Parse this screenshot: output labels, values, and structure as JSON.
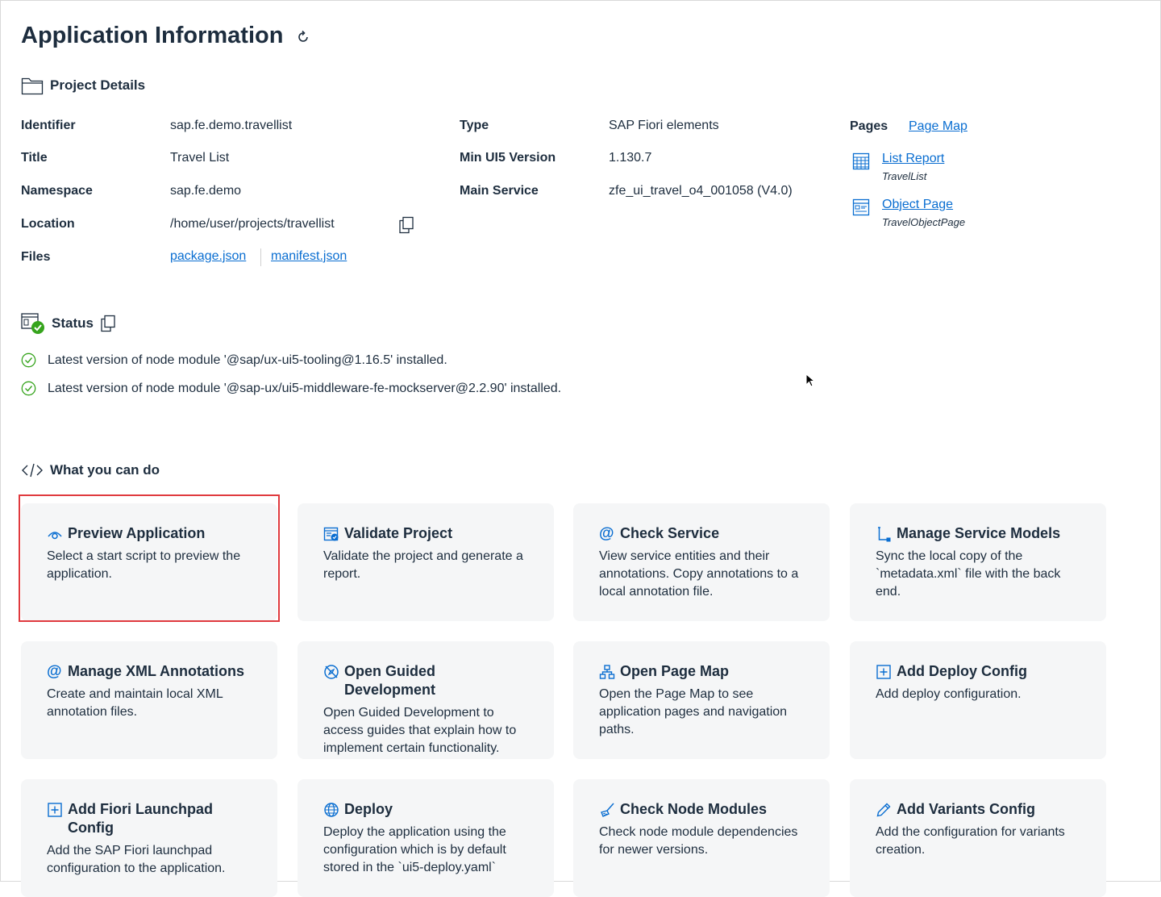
{
  "page": {
    "title": "Application Information"
  },
  "project_details": {
    "heading": "Project Details",
    "identifier_label": "Identifier",
    "identifier_value": "sap.fe.demo.travellist",
    "title_label": "Title",
    "title_value": "Travel List",
    "namespace_label": "Namespace",
    "namespace_value": "sap.fe.demo",
    "location_label": "Location",
    "location_value": "/home/user/projects/travellist",
    "files_label": "Files",
    "files": [
      "package.json",
      "manifest.json"
    ],
    "type_label": "Type",
    "type_value": "SAP Fiori elements",
    "min_ui5_label": "Min UI5 Version",
    "min_ui5_value": "1.130.7",
    "main_service_label": "Main Service",
    "main_service_value": "zfe_ui_travel_o4_001058 (V4.0)",
    "pages_label": "Pages",
    "page_map_link": "Page Map",
    "pages": [
      {
        "name": "List Report",
        "entity": "TravelList",
        "icon": "table-icon"
      },
      {
        "name": "Object Page",
        "entity": "TravelObjectPage",
        "icon": "form-icon"
      }
    ]
  },
  "status": {
    "heading": "Status",
    "items": [
      "Latest version of node module '@sap/ux-ui5-tooling@1.16.5' installed.",
      "Latest version of node module '@sap-ux/ui5-middleware-fe-mockserver@2.2.90' installed."
    ]
  },
  "actions": {
    "heading": "What you can do",
    "cards": [
      {
        "title": "Preview Application",
        "desc": "Select a start script to preview the application.",
        "icon": "eye-icon"
      },
      {
        "title": "Validate Project",
        "desc": "Validate the project and generate a report.",
        "icon": "validate-icon"
      },
      {
        "title": "Check Service",
        "desc": "View service entities and their annotations. Copy annotations to a local annotation file.",
        "icon": "at-icon"
      },
      {
        "title": "Manage Service Models",
        "desc": "Sync the local copy of the `metadata.xml` file with the back end.",
        "icon": "model-icon"
      },
      {
        "title": "Manage XML Annotations",
        "desc": "Create and maintain local XML annotation files.",
        "icon": "at-icon"
      },
      {
        "title": "Open Guided Development",
        "desc": "Open Guided Development to access guides that explain how to implement certain functionality.",
        "icon": "guide-icon"
      },
      {
        "title": "Open Page Map",
        "desc": "Open the Page Map to see application pages and navigation paths.",
        "icon": "hierarchy-icon"
      },
      {
        "title": "Add Deploy Config",
        "desc": "Add deploy configuration.",
        "icon": "add-icon"
      },
      {
        "title": "Add Fiori Launchpad Config",
        "desc": "Add the SAP Fiori launchpad configuration to the application.",
        "icon": "add-icon"
      },
      {
        "title": "Deploy",
        "desc": "Deploy the application using the configuration which is by default stored in the `ui5-deploy.yaml`",
        "icon": "globe-icon"
      },
      {
        "title": "Check Node Modules",
        "desc": "Check node module dependencies for newer versions.",
        "icon": "broom-icon"
      },
      {
        "title": "Add Variants Config",
        "desc": "Add the configuration for variants creation.",
        "icon": "pencil-icon"
      }
    ]
  },
  "colors": {
    "link": "#0a6ed1",
    "card_bg": "#f5f6f7",
    "success": "#36a41d",
    "highlight": "#e03a3e"
  }
}
